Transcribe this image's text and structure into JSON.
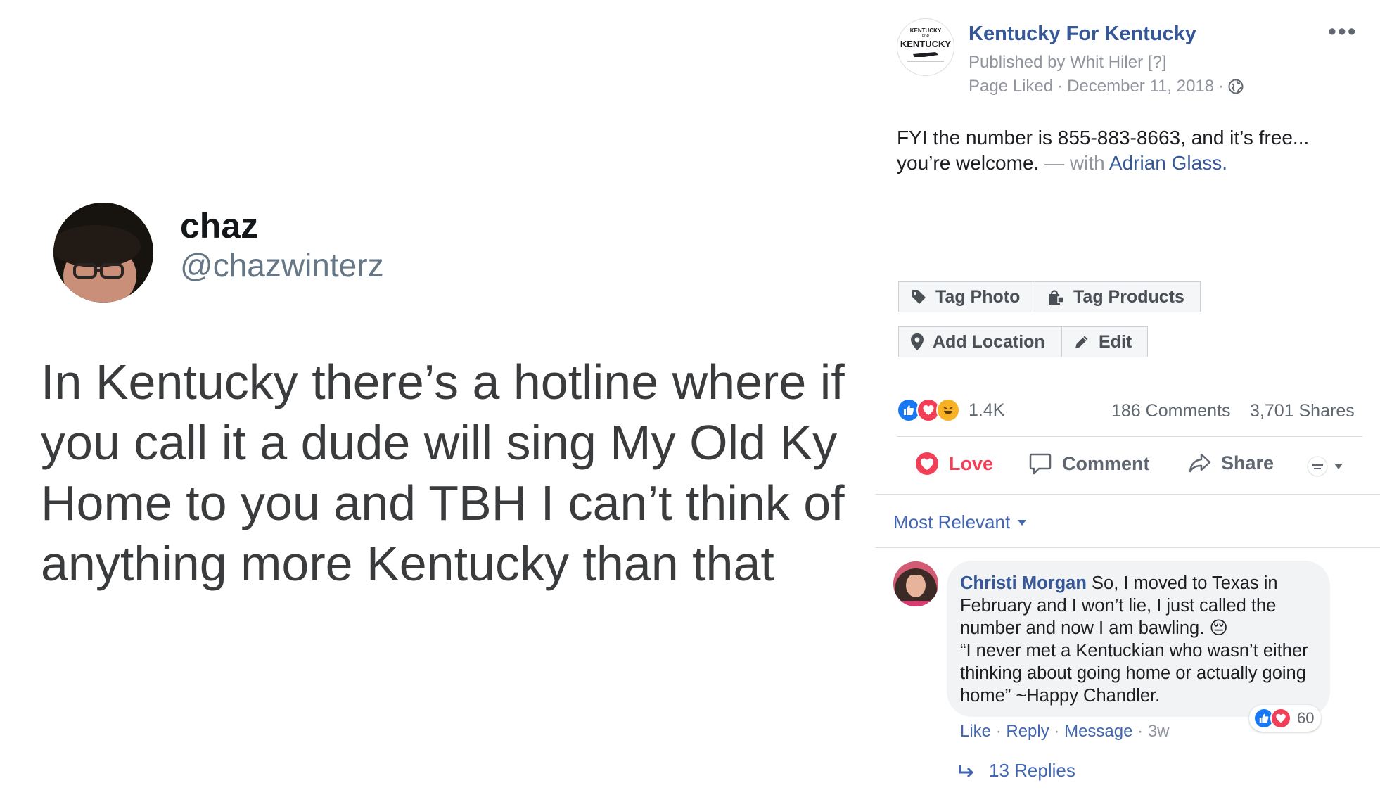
{
  "tweet": {
    "name": "chaz",
    "handle": "@chazwinterz",
    "text": "In Kentucky there’s a hotline where if you call it a dude will sing My Old Ky Home to you and TBH I can’t think of anything more Kentucky than that"
  },
  "post": {
    "page_logo_text": [
      "KENTUCKY",
      "FOR",
      "KENTUCKY"
    ],
    "page_name": "Kentucky For Kentucky",
    "published_prefix": "Published by Whit Hiler",
    "published_help": "[?]",
    "page_liked": "Page Liked",
    "separator": "·",
    "date": "December 11, 2018",
    "more_icon": "more-icon",
    "text_main": "FYI the number is 855-883-8663, and it’s free... you’re welcome.",
    "with_label": "— with",
    "with_name": "Adrian Glass."
  },
  "tag_buttons": {
    "tag_photo": "Tag Photo",
    "tag_products": "Tag Products",
    "add_location": "Add Location",
    "edit": "Edit"
  },
  "stats": {
    "reaction_count": "1.4K",
    "comments": "186 Comments",
    "shares": "3,701 Shares"
  },
  "actions": {
    "love": "Love",
    "comment": "Comment",
    "share": "Share"
  },
  "filter": {
    "label": "Most Relevant"
  },
  "comment": {
    "author": "Christi Morgan",
    "text_1": "So, I moved to Texas in February and I won’t lie, I just called the number and now I am bawling.",
    "emoji": "😔",
    "text_2": "“I never met a Kentuckian who wasn’t either thinking about going home or actually going home” ~Happy Chandler.",
    "reaction_count": "60",
    "like": "Like",
    "reply": "Reply",
    "message": "Message",
    "time": "3w",
    "replies": "13 Replies"
  },
  "colors": {
    "fb_link": "#365899",
    "fb_blue": "#4267b2",
    "love_red": "#f33e58",
    "muted": "#90949c"
  }
}
